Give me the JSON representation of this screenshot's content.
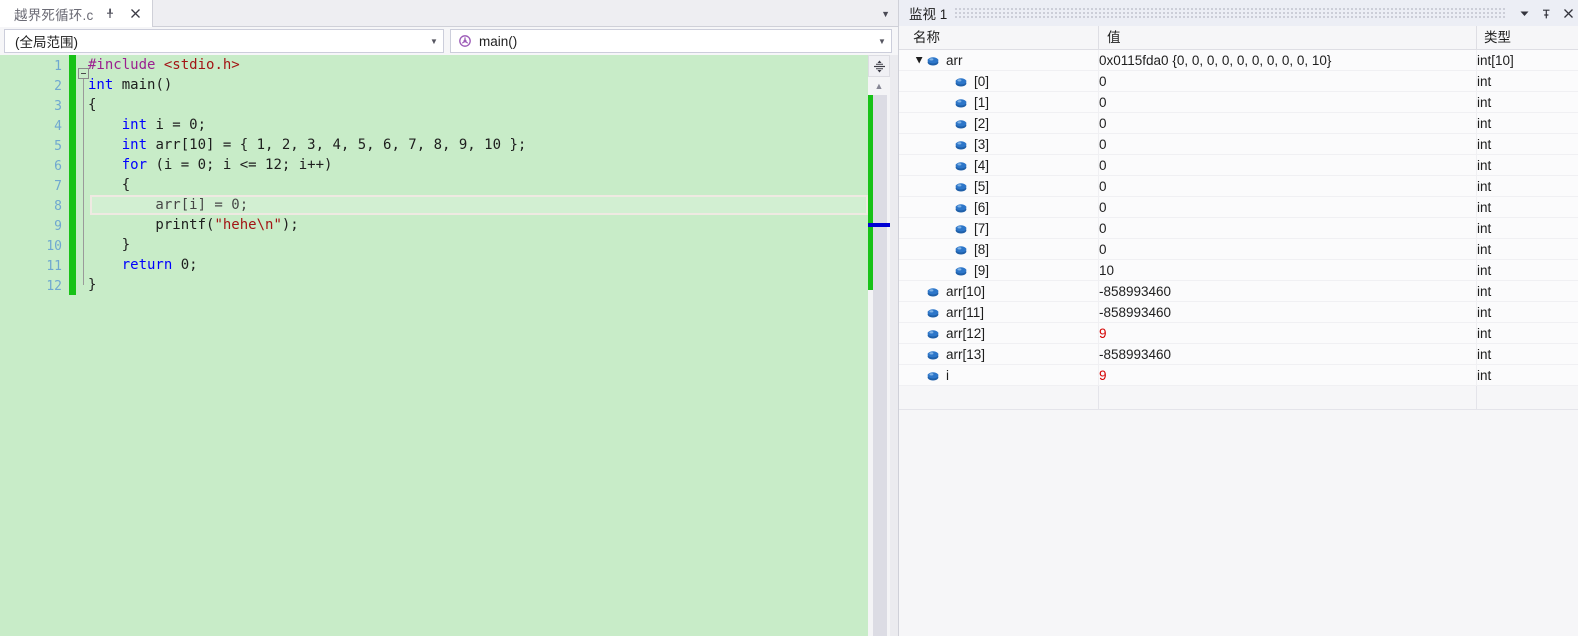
{
  "editor": {
    "tab": {
      "title": "越界死循环.c",
      "pin_icon": "pin-icon",
      "close_icon": "close-icon",
      "overflow_icon": "chevron-down-icon"
    },
    "nav": {
      "scope_value": "(全局范围)",
      "member_value": "main()",
      "member_icon": "method-icon",
      "dropdown_icon": "chevron-down-icon"
    },
    "line_numbers": [
      "1",
      "2",
      "3",
      "4",
      "5",
      "6",
      "7",
      "8",
      "9",
      "10",
      "11",
      "12"
    ],
    "code": [
      {
        "n": 1,
        "text": "#include <stdio.h>"
      },
      {
        "n": 2,
        "text": "int main()"
      },
      {
        "n": 3,
        "text": "{"
      },
      {
        "n": 4,
        "text": "    int i = 0;"
      },
      {
        "n": 5,
        "text": "    int arr[10] = { 1, 2, 3, 4, 5, 6, 7, 8, 9, 10 };"
      },
      {
        "n": 6,
        "text": "    for (i = 0; i <= 12; i++)"
      },
      {
        "n": 7,
        "text": "    {"
      },
      {
        "n": 8,
        "text": "        arr[i] = 0;"
      },
      {
        "n": 9,
        "text": "        printf(\"hehe\\n\");"
      },
      {
        "n": 10,
        "text": "    }"
      },
      {
        "n": 11,
        "text": "    return 0;"
      },
      {
        "n": 12,
        "text": "}"
      }
    ],
    "current_line": 8,
    "scrollbar": {
      "split_icon": "split-window-icon",
      "up_arrow_icon": "caret-up-icon"
    }
  },
  "watch": {
    "title": "监视 1",
    "window_buttons": {
      "dropdown_icon": "chevron-down-icon",
      "pin_icon": "pin-icon",
      "close_icon": "close-icon"
    },
    "columns": {
      "name": "名称",
      "value": "值",
      "type": "类型"
    },
    "rows": [
      {
        "name": "arr",
        "value": "0x0115fda0 {0, 0, 0, 0, 0, 0, 0, 0, 0, 10}",
        "type": "int[10]",
        "indent": 0,
        "expander": "expanded",
        "changed": false
      },
      {
        "name": "[0]",
        "value": "0",
        "type": "int",
        "indent": 1,
        "expander": "none",
        "changed": false
      },
      {
        "name": "[1]",
        "value": "0",
        "type": "int",
        "indent": 1,
        "expander": "none",
        "changed": false
      },
      {
        "name": "[2]",
        "value": "0",
        "type": "int",
        "indent": 1,
        "expander": "none",
        "changed": false
      },
      {
        "name": "[3]",
        "value": "0",
        "type": "int",
        "indent": 1,
        "expander": "none",
        "changed": false
      },
      {
        "name": "[4]",
        "value": "0",
        "type": "int",
        "indent": 1,
        "expander": "none",
        "changed": false
      },
      {
        "name": "[5]",
        "value": "0",
        "type": "int",
        "indent": 1,
        "expander": "none",
        "changed": false
      },
      {
        "name": "[6]",
        "value": "0",
        "type": "int",
        "indent": 1,
        "expander": "none",
        "changed": false
      },
      {
        "name": "[7]",
        "value": "0",
        "type": "int",
        "indent": 1,
        "expander": "none",
        "changed": false
      },
      {
        "name": "[8]",
        "value": "0",
        "type": "int",
        "indent": 1,
        "expander": "none",
        "changed": false
      },
      {
        "name": "[9]",
        "value": "10",
        "type": "int",
        "indent": 1,
        "expander": "none",
        "changed": false
      },
      {
        "name": "arr[10]",
        "value": "-858993460",
        "type": "int",
        "indent": 0,
        "expander": "none",
        "changed": false
      },
      {
        "name": "arr[11]",
        "value": "-858993460",
        "type": "int",
        "indent": 0,
        "expander": "none",
        "changed": false
      },
      {
        "name": "arr[12]",
        "value": "9",
        "type": "int",
        "indent": 0,
        "expander": "none",
        "changed": true
      },
      {
        "name": "arr[13]",
        "value": "-858993460",
        "type": "int",
        "indent": 0,
        "expander": "none",
        "changed": false
      },
      {
        "name": "i",
        "value": "9",
        "type": "int",
        "indent": 0,
        "expander": "none",
        "changed": true
      }
    ],
    "new_row_placeholder": ""
  },
  "colors": {
    "editor_background": "#c8ecc8",
    "change_bar": "#17c217",
    "keyword": "#0000ff",
    "preprocessor": "#9b1f8f",
    "string": "#a31515",
    "line_number": "#6fa8d0",
    "changed_value": "#d40000",
    "current_marker": "#0000d4"
  }
}
